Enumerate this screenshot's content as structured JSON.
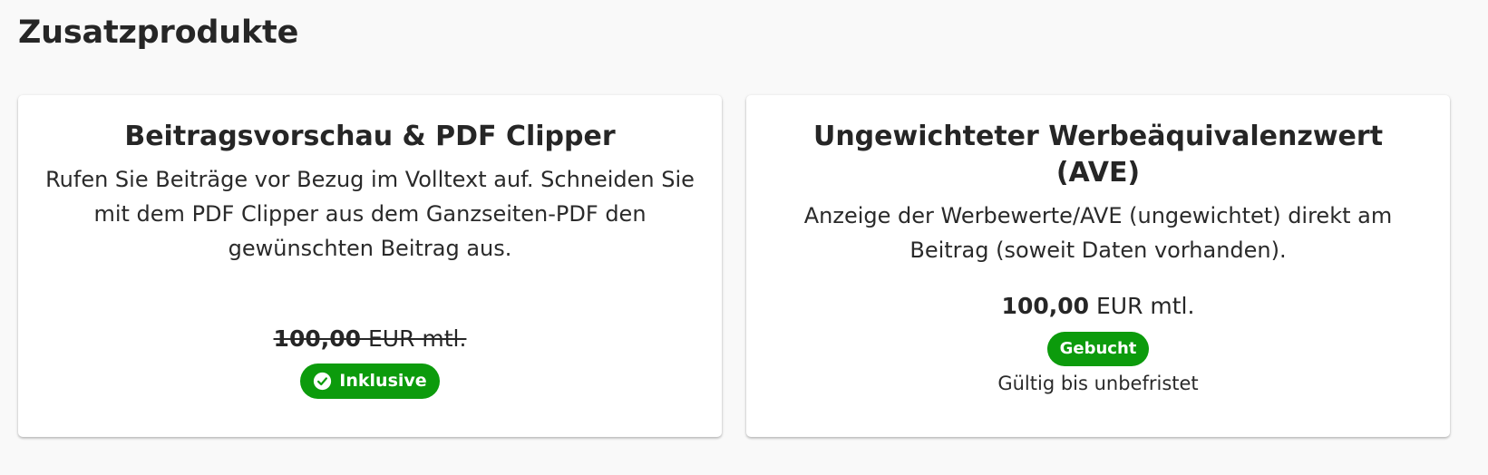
{
  "section": {
    "title": "Zusatzprodukte"
  },
  "cards": [
    {
      "title": "Beitragsvorschau & PDF Clipper",
      "description": "Rufen Sie Beiträge vor Bezug im Volltext auf. Schneiden Sie mit dem PDF Clipper aus dem Ganzseiten-PDF den gewünschten Beitrag aus.",
      "price_amount": "100,00",
      "price_unit": " EUR mtl.",
      "price_struck": true,
      "badge_label": "Inklusive",
      "badge_icon": "check-circle-icon"
    },
    {
      "title": "Ungewichteter Werbeäquivalenzwert (AVE)",
      "description": "Anzeige der Werbewerte/AVE (ungewichtet) direkt am Beitrag (soweit Daten vorhanden).",
      "price_amount": "100,00",
      "price_unit": " EUR mtl.",
      "price_struck": false,
      "badge_label": "Gebucht",
      "valid_text": "Gültig bis unbefristet"
    }
  ],
  "colors": {
    "badge_green": "#0c9b0c",
    "background": "#f9f9f9",
    "card": "#ffffff"
  }
}
